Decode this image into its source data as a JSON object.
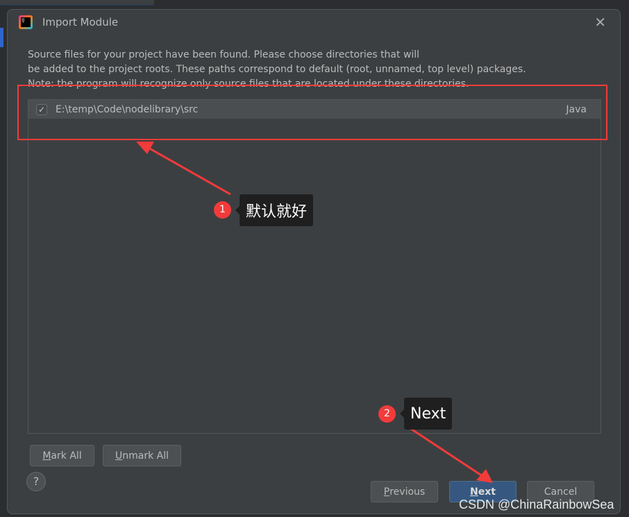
{
  "window": {
    "title": "Import Module"
  },
  "description": [
    "Source files for your project have been found. Please choose directories that will",
    "be added to the project roots. These paths correspond to default (root, unnamed, top level) packages.",
    "Note: the program will recognize only source files that are located under these directories."
  ],
  "roots": [
    {
      "checked": true,
      "path": "E:\\temp\\Code\\nodelibrary\\src",
      "type": "Java"
    }
  ],
  "buttons": {
    "mark_all": {
      "m": "M",
      "rest": "ark All"
    },
    "unmark_all": {
      "m": "U",
      "rest": "nmark All"
    },
    "previous": {
      "m": "P",
      "rest": "revious"
    },
    "next": {
      "m": "N",
      "rest": "ext"
    },
    "cancel": "Cancel",
    "help": "?"
  },
  "annotations": [
    {
      "number": "1",
      "text": "默认就好"
    },
    {
      "number": "2",
      "text": "Next"
    }
  ],
  "watermark": "CSDN @ChinaRainbowSea",
  "colors": {
    "accent": "#365880",
    "annotation": "#f23b3b"
  }
}
